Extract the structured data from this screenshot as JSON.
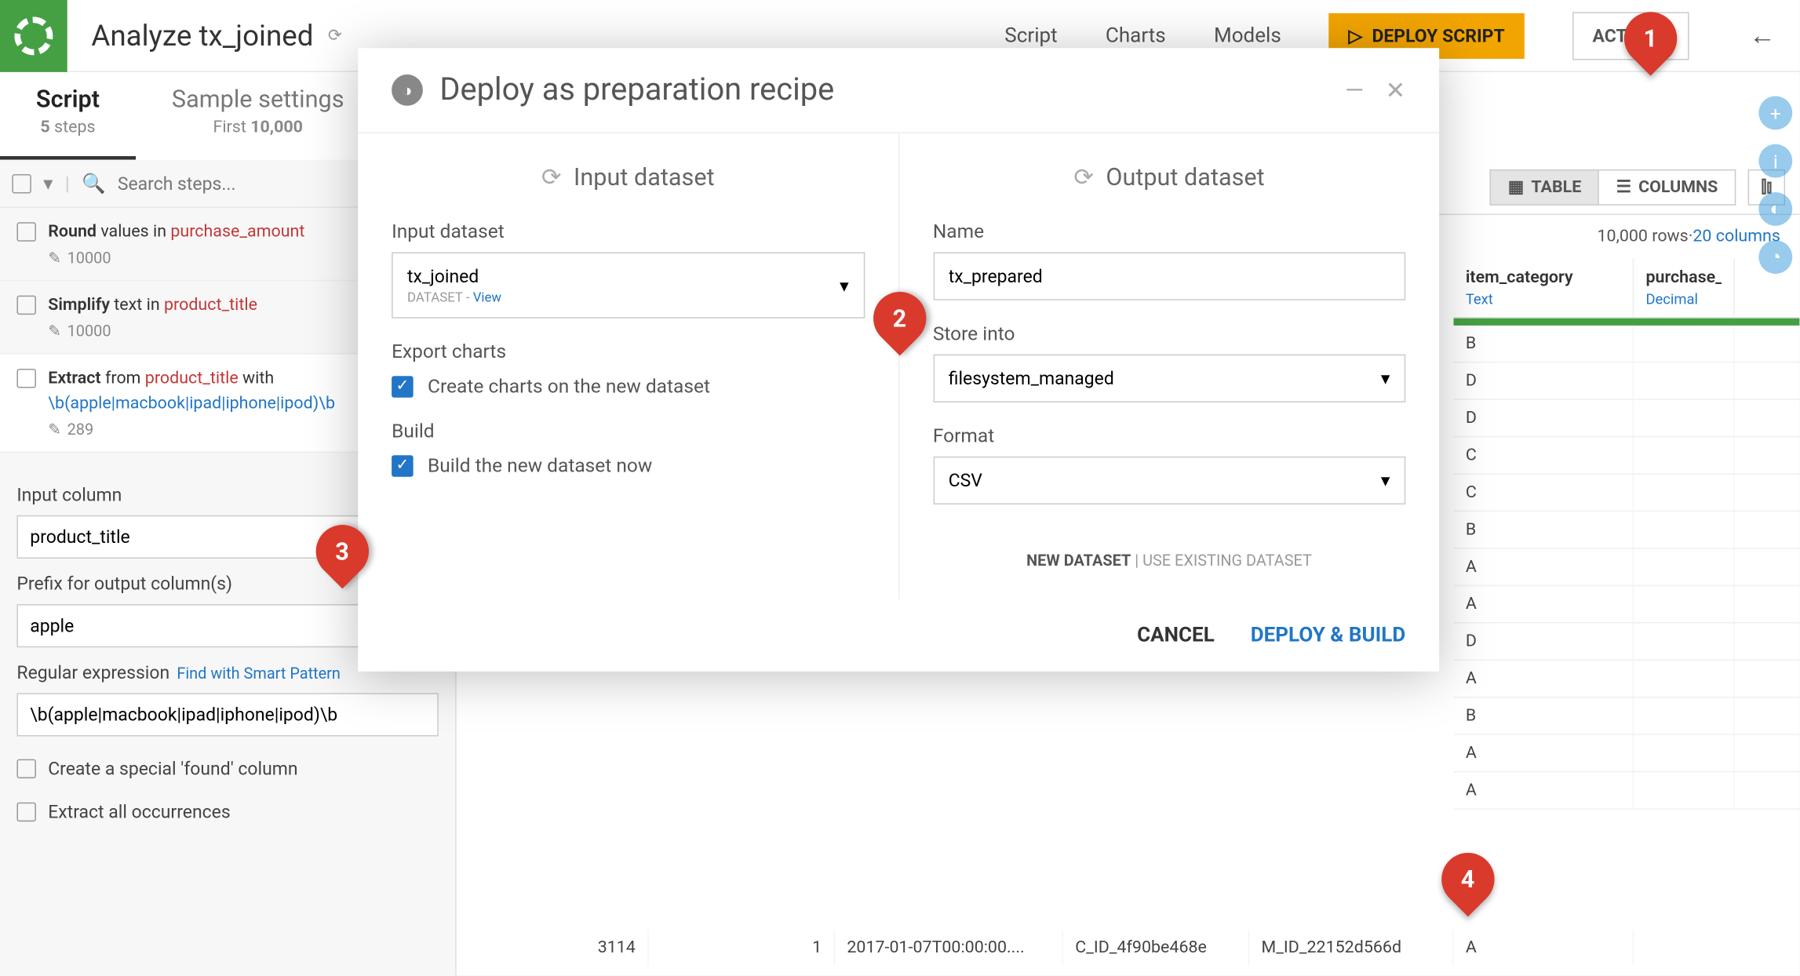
{
  "header": {
    "title": "Analyze tx_joined",
    "nav": {
      "script": "Script",
      "charts": "Charts",
      "models": "Models"
    },
    "deploy_btn": "DEPLOY SCRIPT",
    "actions_btn": "ACTIONS"
  },
  "tabs": {
    "script": {
      "label": "Script",
      "sub_count": "5",
      "sub_text": "steps"
    },
    "sample": {
      "label": "Sample settings",
      "sub_prefix": "First",
      "sub_count": "10,000"
    }
  },
  "sidebar": {
    "search_placeholder": "Search steps...",
    "steps": [
      {
        "bold": "Round",
        "plain": " values in ",
        "hl": "purchase_amount",
        "count": "10000"
      },
      {
        "bold": "Simplify",
        "plain": " text in ",
        "hl": "product_title",
        "count": "10000"
      },
      {
        "bold": "Extract",
        "plain": " from ",
        "hl": "product_title",
        "tail": " with",
        "regex": "\\b(apple|macbook|ipad|iphone|ipod)\\b",
        "count": "289"
      }
    ],
    "form": {
      "input_column_label": "Input column",
      "input_column_value": "product_title",
      "prefix_label": "Prefix for output column(s)",
      "prefix_value": "apple",
      "regex_label": "Regular expression",
      "regex_link": "Find with Smart Pattern",
      "regex_value": "\\b(apple|macbook|ipad|iphone|ipod)\\b",
      "found_checkbox": "Create a special 'found' column",
      "extract_checkbox": "Extract all occurrences"
    }
  },
  "toolbar": {
    "table_btn": "TABLE",
    "columns_btn": "COLUMNS"
  },
  "stats": {
    "rows": "10,000 rows",
    "sep": " · ",
    "cols": "20 columns"
  },
  "columns": [
    {
      "name": "item_category",
      "type": "Text",
      "width": 150
    },
    {
      "name": "purchase_amount",
      "type": "Decimal",
      "width": 90
    }
  ],
  "table_rows": [
    [
      "B"
    ],
    [
      "D"
    ],
    [
      "D"
    ],
    [
      "C"
    ],
    [
      "C"
    ],
    [
      "B"
    ],
    [
      "A"
    ],
    [
      "A"
    ],
    [
      "D"
    ],
    [
      "A"
    ],
    [
      "B"
    ],
    [
      "A"
    ],
    [
      "A"
    ]
  ],
  "bottom_row": {
    "c1": "3114",
    "c2": "1",
    "c3": "2017-01-07T00:00:00....",
    "c4": "C_ID_4f90be468e",
    "c5": "M_ID_22152d566d",
    "c6": "A"
  },
  "bottom_row2": {
    "c1": "",
    "c2": "",
    "c3": "",
    "c4": "",
    "c5": "",
    "c6": ""
  },
  "modal": {
    "title": "Deploy as preparation recipe",
    "input": {
      "title": "Input dataset",
      "dataset_label": "Input dataset",
      "dataset_value": "tx_joined",
      "dataset_sub_type": "DATASET",
      "dataset_sub_view": "View",
      "export_label": "Export charts",
      "export_check": "Create charts on the new dataset",
      "build_label": "Build",
      "build_check": "Build the new dataset now"
    },
    "output": {
      "title": "Output dataset",
      "name_label": "Name",
      "name_value": "tx_prepared",
      "store_label": "Store into",
      "store_value": "filesystem_managed",
      "format_label": "Format",
      "format_value": "CSV",
      "toggle_new": "NEW DATASET",
      "toggle_sep": " | ",
      "toggle_existing": "USE EXISTING DATASET"
    },
    "footer": {
      "cancel": "CANCEL",
      "deploy": "DEPLOY & BUILD"
    }
  },
  "callouts": {
    "c1": "1",
    "c2": "2",
    "c3": "3",
    "c4": "4"
  }
}
